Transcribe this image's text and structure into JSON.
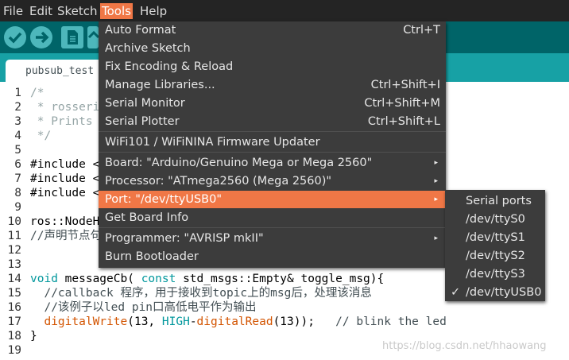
{
  "menubar": {
    "items": [
      "File",
      "Edit",
      "Sketch",
      "Tools",
      "Help"
    ]
  },
  "tab": {
    "label": "pubsub_test"
  },
  "editor": {
    "lines": [
      {
        "num": "1",
        "parts": [
          {
            "t": "/*",
            "c": "cm"
          }
        ]
      },
      {
        "num": "2",
        "parts": [
          {
            "t": " * rosseri",
            "c": "cm"
          }
        ]
      },
      {
        "num": "3",
        "parts": [
          {
            "t": " * Prints",
            "c": "cm"
          }
        ]
      },
      {
        "num": "4",
        "parts": [
          {
            "t": " */",
            "c": "cm"
          }
        ]
      },
      {
        "num": "5",
        "parts": []
      },
      {
        "num": "6",
        "parts": [
          {
            "t": "#include <",
            "c": ""
          }
        ]
      },
      {
        "num": "7",
        "parts": [
          {
            "t": "#include <",
            "c": ""
          }
        ]
      },
      {
        "num": "8",
        "parts": [
          {
            "t": "#include <",
            "c": ""
          }
        ]
      },
      {
        "num": "9",
        "parts": []
      },
      {
        "num": "10",
        "parts": [
          {
            "t": "ros::NodeH",
            "c": ""
          }
        ]
      },
      {
        "num": "11",
        "parts": [
          {
            "t": "//声明节点句",
            "c": "cm2"
          }
        ]
      },
      {
        "num": "12",
        "parts": []
      },
      {
        "num": "13",
        "parts": []
      },
      {
        "num": "14",
        "parts": [
          {
            "t": "void",
            "c": "kw"
          },
          {
            "t": " messageCb( ",
            "c": ""
          },
          {
            "t": "const",
            "c": "kw"
          },
          {
            "t": " std_msgs::Empty& toggle_msg){",
            "c": ""
          }
        ]
      },
      {
        "num": "15",
        "parts": [
          {
            "t": "  //callback 程序，用于接收到topic上的msg后，处理该消息",
            "c": "cm2"
          }
        ]
      },
      {
        "num": "16",
        "parts": [
          {
            "t": "  //该例子以led pin口高低电平作为输出",
            "c": "cm2"
          }
        ]
      },
      {
        "num": "17",
        "parts": [
          {
            "t": "  ",
            "c": ""
          },
          {
            "t": "digitalWrite",
            "c": "fn"
          },
          {
            "t": "(13, ",
            "c": ""
          },
          {
            "t": "HIGH",
            "c": "kw"
          },
          {
            "t": "-",
            "c": ""
          },
          {
            "t": "digitalRead",
            "c": "fn"
          },
          {
            "t": "(13));   ",
            "c": ""
          },
          {
            "t": "// blink the led",
            "c": "cm2"
          }
        ]
      },
      {
        "num": "18",
        "parts": [
          {
            "t": "}",
            "c": ""
          }
        ]
      },
      {
        "num": "19",
        "parts": []
      }
    ]
  },
  "tools_menu": {
    "items": [
      {
        "label": "Auto Format",
        "shortcut": "Ctrl+T"
      },
      {
        "label": "Archive Sketch",
        "shortcut": ""
      },
      {
        "label": "Fix Encoding & Reload",
        "shortcut": ""
      },
      {
        "label": "Manage Libraries...",
        "shortcut": "Ctrl+Shift+I"
      },
      {
        "label": "Serial Monitor",
        "shortcut": "Ctrl+Shift+M"
      },
      {
        "label": "Serial Plotter",
        "shortcut": "Ctrl+Shift+L"
      },
      {
        "label": "WiFi101 / WiFiNINA Firmware Updater",
        "shortcut": ""
      },
      {
        "label": "Board: \"Arduino/Genuino Mega or Mega 2560\"",
        "shortcut": ""
      },
      {
        "label": "Processor: \"ATmega2560 (Mega 2560)\"",
        "shortcut": ""
      },
      {
        "label": "Port: \"/dev/ttyUSB0\"",
        "shortcut": ""
      },
      {
        "label": "Get Board Info",
        "shortcut": ""
      },
      {
        "label": "Programmer: \"AVRISP mkII\"",
        "shortcut": ""
      },
      {
        "label": "Burn Bootloader",
        "shortcut": ""
      }
    ]
  },
  "port_submenu": {
    "header": "Serial ports",
    "items": [
      "/dev/ttyS0",
      "/dev/ttyS1",
      "/dev/ttyS2",
      "/dev/ttyS3",
      "/dev/ttyUSB0"
    ],
    "check": "✓"
  },
  "watermark": "https://blog.csdn.net/hhaowang",
  "colors": {
    "accent": "#f07746",
    "toolbar": "#006468",
    "tabbar": "#17a1a5",
    "menubar": "#242424",
    "menu": "#3c3c3c"
  }
}
